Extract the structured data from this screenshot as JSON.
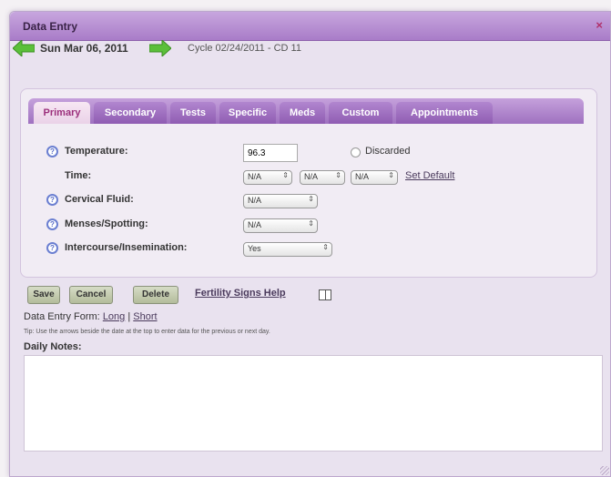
{
  "dialog": {
    "title": "Data Entry",
    "close_label": "×"
  },
  "datebar": {
    "date": "Sun Mar 06, 2011",
    "cycle": "Cycle 02/24/2011 - CD 11"
  },
  "tabs": [
    {
      "label": "Primary",
      "active": true
    },
    {
      "label": "Secondary"
    },
    {
      "label": "Tests"
    },
    {
      "label": "Specific"
    },
    {
      "label": "Meds"
    },
    {
      "label": "Custom"
    },
    {
      "label": "Appointments"
    }
  ],
  "form": {
    "temperature_label": "Temperature:",
    "temperature_value": "96.3",
    "discarded_label": "Discarded",
    "time_label": "Time:",
    "time_hour": "N/A",
    "time_minute": "N/A",
    "time_ampm": "N/A",
    "set_default_label": "Set Default",
    "cervical_label": "Cervical Fluid:",
    "cervical_value": "N/A",
    "menses_label": "Menses/Spotting:",
    "menses_value": "N/A",
    "intercourse_label": "Intercourse/Insemination:",
    "intercourse_value": "Yes"
  },
  "actions": {
    "save": "Save",
    "cancel": "Cancel",
    "delete": "Delete",
    "help": "Fertility Signs Help"
  },
  "entry_form": {
    "label": "Data Entry Form:",
    "long": "Long",
    "separator": "|",
    "short": "Short"
  },
  "tip": "Tip: Use the arrows beside the date at the top to enter data for the previous or next day.",
  "notes": {
    "label": "Daily Notes:",
    "value": ""
  },
  "colors": {
    "titlebar": "#a97cc8",
    "tab_active_text": "#9b2f7c",
    "arrow": "#5bbf3a",
    "button": "#c4cbb0"
  }
}
